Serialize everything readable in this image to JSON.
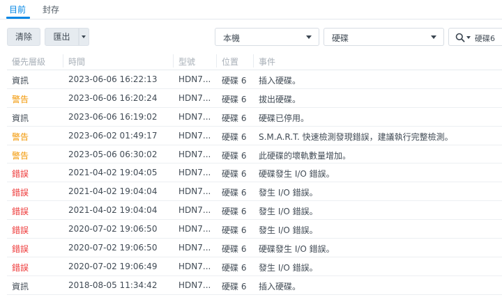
{
  "colors": {
    "accent": "#0086e5",
    "warning": "#f29600",
    "error": "#ee3a3a"
  },
  "tabs": [
    {
      "label": "目前",
      "active": true
    },
    {
      "label": "封存",
      "active": false
    }
  ],
  "toolbar": {
    "clear_label": "清除",
    "export_label": "匯出",
    "source_filter": "本機",
    "device_filter": "硬碟",
    "search_value": "硬碟6",
    "search_icon": "search-icon"
  },
  "table": {
    "columns": [
      "優先層級",
      "時間",
      "型號",
      "位置",
      "事件"
    ],
    "rows": [
      {
        "level": "資訊",
        "severity": "info",
        "time": "2023-06-06 16:22:13",
        "model": "HDN7...",
        "location": "硬碟 6",
        "event": "插入硬碟。"
      },
      {
        "level": "警告",
        "severity": "warn",
        "time": "2023-06-06 16:20:24",
        "model": "HDN7...",
        "location": "硬碟 6",
        "event": "拔出硬碟。"
      },
      {
        "level": "資訊",
        "severity": "info",
        "time": "2023-06-06 16:19:02",
        "model": "HDN7...",
        "location": "硬碟 6",
        "event": "硬碟已停用。"
      },
      {
        "level": "警告",
        "severity": "warn",
        "time": "2023-06-02 01:49:17",
        "model": "HDN7...",
        "location": "硬碟 6",
        "event": "S.M.A.R.T. 快速檢測發現錯誤，建議執行完整檢測。"
      },
      {
        "level": "警告",
        "severity": "warn",
        "time": "2023-05-06 06:30:02",
        "model": "HDN7...",
        "location": "硬碟 6",
        "event": "此硬碟的壞軌數量增加。"
      },
      {
        "level": "錯誤",
        "severity": "err",
        "time": "2021-04-02 19:04:05",
        "model": "HDN7...",
        "location": "硬碟 6",
        "event": "硬碟發生 I/O 錯誤。"
      },
      {
        "level": "錯誤",
        "severity": "err",
        "time": "2021-04-02 19:04:04",
        "model": "HDN7...",
        "location": "硬碟 6",
        "event": "發生 I/O 錯誤。"
      },
      {
        "level": "錯誤",
        "severity": "err",
        "time": "2021-04-02 19:04:04",
        "model": "HDN7...",
        "location": "硬碟 6",
        "event": "發生 I/O 錯誤。"
      },
      {
        "level": "錯誤",
        "severity": "err",
        "time": "2020-07-02 19:06:50",
        "model": "HDN7...",
        "location": "硬碟 6",
        "event": "發生 I/O 錯誤。"
      },
      {
        "level": "錯誤",
        "severity": "err",
        "time": "2020-07-02 19:06:50",
        "model": "HDN7...",
        "location": "硬碟 6",
        "event": "硬碟發生 I/O 錯誤。"
      },
      {
        "level": "錯誤",
        "severity": "err",
        "time": "2020-07-02 19:06:49",
        "model": "HDN7...",
        "location": "硬碟 6",
        "event": "發生 I/O 錯誤。"
      },
      {
        "level": "資訊",
        "severity": "info",
        "time": "2018-08-05 11:34:42",
        "model": "HDN7...",
        "location": "硬碟 6",
        "event": "插入硬碟。"
      }
    ]
  }
}
